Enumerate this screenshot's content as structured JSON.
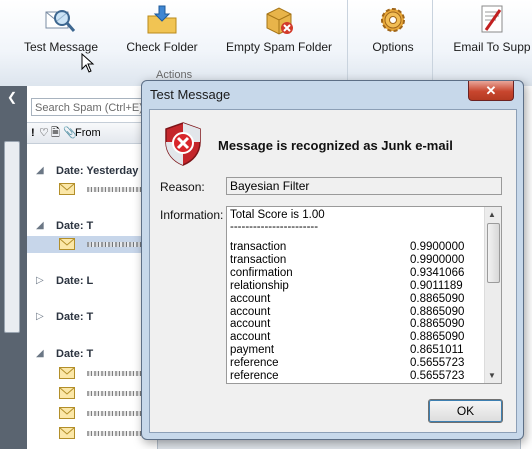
{
  "ribbon": {
    "buttons": [
      {
        "label": "Test Message",
        "icon": "magnifier-mail-icon"
      },
      {
        "label": "Check Folder",
        "icon": "folder-down-arrow-icon"
      },
      {
        "label": "Empty Spam Folder",
        "icon": "empty-spam-box-icon"
      },
      {
        "label": "Options",
        "icon": "gear-icon"
      },
      {
        "label": "Email To Supp",
        "icon": "email-support-icon"
      }
    ],
    "group_label": "Actions"
  },
  "list": {
    "search_placeholder": "Search Spam (Ctrl+E)",
    "col_from": "From",
    "groups": [
      {
        "label": "Date: Yesterday"
      },
      {
        "label": "Date: T"
      },
      {
        "label": "Date: L"
      },
      {
        "label": "Date: T"
      },
      {
        "label": "Date: T"
      }
    ]
  },
  "dialog": {
    "title": "Test Message",
    "close": "✕",
    "heading": "Message is recognized as Junk e-mail",
    "reason_label": "Reason:",
    "reason_value": "Bayesian Filter",
    "info_label": "Information:",
    "info_total": "Total Score is 1.00",
    "info_rule": "-----------------------",
    "scores": [
      {
        "word": "transaction",
        "score": "0.9900000"
      },
      {
        "word": "transaction",
        "score": "0.9900000"
      },
      {
        "word": "confirmation",
        "score": "0.9341066"
      },
      {
        "word": "relationship",
        "score": "0.9011189"
      },
      {
        "word": "account",
        "score": "0.8865090"
      },
      {
        "word": "account",
        "score": "0.8865090"
      },
      {
        "word": "account",
        "score": "0.8865090"
      },
      {
        "word": "account",
        "score": "0.8865090"
      },
      {
        "word": "payment",
        "score": "0.8651011"
      },
      {
        "word": "reference",
        "score": "0.5655723"
      },
      {
        "word": "reference",
        "score": "0.5655723"
      }
    ],
    "ok_label": "OK"
  },
  "colors": {
    "accent": "#c8462e",
    "selection": "#c7d6ea",
    "dialog_frame": "#c7d8ea"
  }
}
